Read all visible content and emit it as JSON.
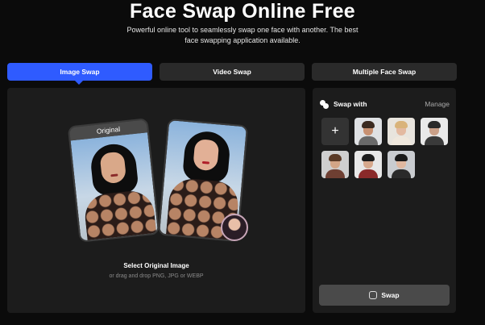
{
  "header": {
    "title": "Face Swap Online Free",
    "subtitle_line1": "Powerful online tool to seamlessly swap one face with another. The best",
    "subtitle_line2": "face swapping application available."
  },
  "tabs": [
    {
      "label": "Image Swap",
      "active": true
    },
    {
      "label": "Video Swap",
      "active": false
    },
    {
      "label": "Multiple Face Swap",
      "active": false
    }
  ],
  "upload": {
    "original_label": "Original",
    "select_label": "Select Original Image",
    "hint": "or drag and drop PNG, JPG or WEBP"
  },
  "swap_panel": {
    "title": "Swap with",
    "manage_label": "Manage",
    "add_label": "+",
    "faces": [
      {
        "name": "face-man-beard",
        "bg": "#dfe1e4",
        "skin": "#c89172",
        "hair": "#3b2a20",
        "shirt": "#6a6a6a"
      },
      {
        "name": "face-woman-blonde",
        "bg": "#e8e4dd",
        "skin": "#e3b9a0",
        "hair": "#d9b37a",
        "shirt": "#efe7dc"
      },
      {
        "name": "face-man-suit",
        "bg": "#e9e9e9",
        "skin": "#caa088",
        "hair": "#2a2a2a",
        "shirt": "#3a3a3a"
      },
      {
        "name": "face-woman-brunette",
        "bg": "#cfcfcf",
        "skin": "#d3a586",
        "hair": "#5a3a26",
        "shirt": "#6e3f32"
      },
      {
        "name": "face-man-young",
        "bg": "#e7e7e7",
        "skin": "#d6a88c",
        "hair": "#1c1c1c",
        "shirt": "#8a2a2a"
      },
      {
        "name": "face-woman-asian",
        "bg": "#c9ccd0",
        "skin": "#e0b8a0",
        "hair": "#1a1a1a",
        "shirt": "#2a2a2a"
      }
    ],
    "swap_button": "Swap"
  },
  "colors": {
    "accent": "#2f5bff",
    "background": "#0b0b0b",
    "panel": "#1c1c1c"
  }
}
